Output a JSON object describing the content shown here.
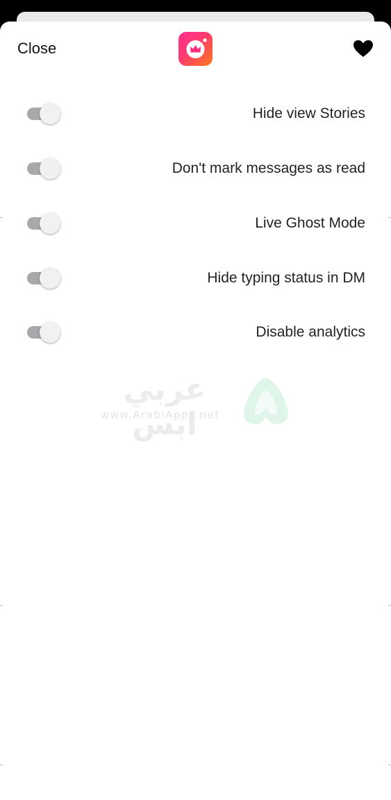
{
  "header": {
    "close_label": "Close",
    "logo_icon": "crown-camera-icon",
    "favorite_icon": "heart-icon"
  },
  "settings": [
    {
      "label": "Hide view Stories",
      "enabled": true
    },
    {
      "label": "Don't mark messages as read",
      "enabled": true
    },
    {
      "label": "Live Ghost Mode",
      "enabled": true
    },
    {
      "label": "Hide typing status in DM",
      "enabled": true
    },
    {
      "label": "Disable analytics",
      "enabled": true
    }
  ],
  "watermark": {
    "arabic_text": "عربي ابس",
    "url_text": "www.ArabiApps.net"
  },
  "colors": {
    "sheet_background": "#ffffff",
    "backdrop": "#000000",
    "logo_gradient_start": "#ff2d92",
    "logo_gradient_end": "#ff7a1a",
    "toggle_track": "#a9a9ab",
    "toggle_knob": "#f1f1f1",
    "text": "#222222"
  }
}
